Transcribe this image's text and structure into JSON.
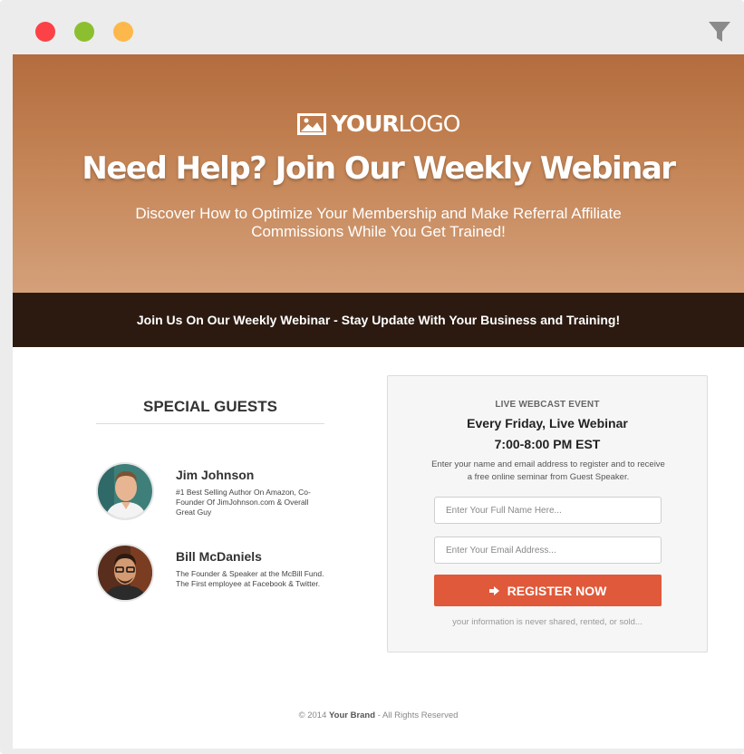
{
  "window": {
    "controls": [
      "close",
      "minimize",
      "maximize"
    ],
    "filter_icon": "filter-icon"
  },
  "hero": {
    "logo_bold": "YOUR",
    "logo_light": "LOGO",
    "logo_icon": "image-icon",
    "title": "Need Help? Join Our Weekly Webinar",
    "subtitle": "Discover How to Optimize Your Membership and Make Referral Affiliate Commissions While You Get Trained!"
  },
  "banner": {
    "text": "Join Us On Our Weekly Webinar - Stay Update With Your Business and Training!"
  },
  "guests": {
    "title": "SPECIAL GUESTS",
    "items": [
      {
        "name": "Jim Johnson",
        "bio": "#1 Best Selling Author On Amazon, Co-Founder Of JimJohnson.com & Overall Great Guy"
      },
      {
        "name": "Bill McDaniels",
        "bio": "The Founder & Speaker at the McBill Fund. The First employee at Facebook & Twitter."
      }
    ]
  },
  "form": {
    "kicker": "LIVE WEBCAST EVENT",
    "schedule": "Every Friday, Live Webinar",
    "time": "7:00-8:00 PM EST",
    "description": "Enter your name and email address to register and to receive a free online seminar from Guest Speaker.",
    "name_placeholder": "Enter Your Full Name Here...",
    "name_value": "",
    "email_placeholder": "Enter Your Email Address...",
    "email_value": "",
    "submit_label": "REGISTER NOW",
    "submit_icon": "sign-in-icon",
    "note": "your information is never shared, rented, or sold..."
  },
  "footer": {
    "prefix": "© 2014",
    "brand": "Your Brand",
    "suffix": "- All Rights Reserved"
  },
  "colors": {
    "hero_top": "#b36c3e",
    "hero_bottom": "#d4a07a",
    "banner_bg": "#2c1a10",
    "cta": "#e0593a"
  }
}
